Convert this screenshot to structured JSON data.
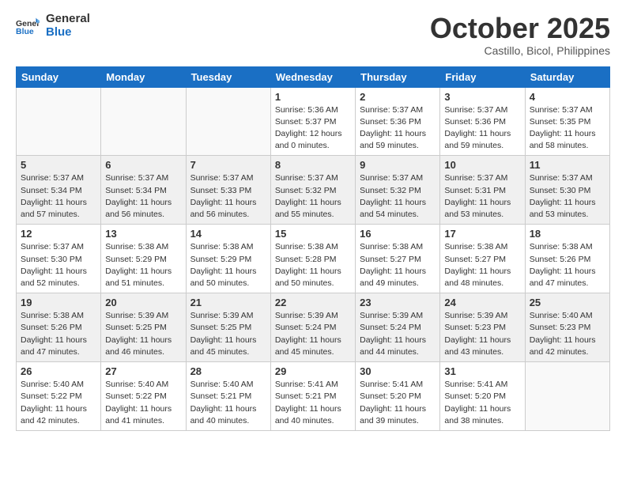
{
  "header": {
    "logo_general": "General",
    "logo_blue": "Blue",
    "month": "October 2025",
    "location": "Castillo, Bicol, Philippines"
  },
  "weekdays": [
    "Sunday",
    "Monday",
    "Tuesday",
    "Wednesday",
    "Thursday",
    "Friday",
    "Saturday"
  ],
  "weeks": [
    [
      {
        "day": "",
        "info": ""
      },
      {
        "day": "",
        "info": ""
      },
      {
        "day": "",
        "info": ""
      },
      {
        "day": "1",
        "info": "Sunrise: 5:36 AM\nSunset: 5:37 PM\nDaylight: 12 hours\nand 0 minutes."
      },
      {
        "day": "2",
        "info": "Sunrise: 5:37 AM\nSunset: 5:36 PM\nDaylight: 11 hours\nand 59 minutes."
      },
      {
        "day": "3",
        "info": "Sunrise: 5:37 AM\nSunset: 5:36 PM\nDaylight: 11 hours\nand 59 minutes."
      },
      {
        "day": "4",
        "info": "Sunrise: 5:37 AM\nSunset: 5:35 PM\nDaylight: 11 hours\nand 58 minutes."
      }
    ],
    [
      {
        "day": "5",
        "info": "Sunrise: 5:37 AM\nSunset: 5:34 PM\nDaylight: 11 hours\nand 57 minutes."
      },
      {
        "day": "6",
        "info": "Sunrise: 5:37 AM\nSunset: 5:34 PM\nDaylight: 11 hours\nand 56 minutes."
      },
      {
        "day": "7",
        "info": "Sunrise: 5:37 AM\nSunset: 5:33 PM\nDaylight: 11 hours\nand 56 minutes."
      },
      {
        "day": "8",
        "info": "Sunrise: 5:37 AM\nSunset: 5:32 PM\nDaylight: 11 hours\nand 55 minutes."
      },
      {
        "day": "9",
        "info": "Sunrise: 5:37 AM\nSunset: 5:32 PM\nDaylight: 11 hours\nand 54 minutes."
      },
      {
        "day": "10",
        "info": "Sunrise: 5:37 AM\nSunset: 5:31 PM\nDaylight: 11 hours\nand 53 minutes."
      },
      {
        "day": "11",
        "info": "Sunrise: 5:37 AM\nSunset: 5:30 PM\nDaylight: 11 hours\nand 53 minutes."
      }
    ],
    [
      {
        "day": "12",
        "info": "Sunrise: 5:37 AM\nSunset: 5:30 PM\nDaylight: 11 hours\nand 52 minutes."
      },
      {
        "day": "13",
        "info": "Sunrise: 5:38 AM\nSunset: 5:29 PM\nDaylight: 11 hours\nand 51 minutes."
      },
      {
        "day": "14",
        "info": "Sunrise: 5:38 AM\nSunset: 5:29 PM\nDaylight: 11 hours\nand 50 minutes."
      },
      {
        "day": "15",
        "info": "Sunrise: 5:38 AM\nSunset: 5:28 PM\nDaylight: 11 hours\nand 50 minutes."
      },
      {
        "day": "16",
        "info": "Sunrise: 5:38 AM\nSunset: 5:27 PM\nDaylight: 11 hours\nand 49 minutes."
      },
      {
        "day": "17",
        "info": "Sunrise: 5:38 AM\nSunset: 5:27 PM\nDaylight: 11 hours\nand 48 minutes."
      },
      {
        "day": "18",
        "info": "Sunrise: 5:38 AM\nSunset: 5:26 PM\nDaylight: 11 hours\nand 47 minutes."
      }
    ],
    [
      {
        "day": "19",
        "info": "Sunrise: 5:38 AM\nSunset: 5:26 PM\nDaylight: 11 hours\nand 47 minutes."
      },
      {
        "day": "20",
        "info": "Sunrise: 5:39 AM\nSunset: 5:25 PM\nDaylight: 11 hours\nand 46 minutes."
      },
      {
        "day": "21",
        "info": "Sunrise: 5:39 AM\nSunset: 5:25 PM\nDaylight: 11 hours\nand 45 minutes."
      },
      {
        "day": "22",
        "info": "Sunrise: 5:39 AM\nSunset: 5:24 PM\nDaylight: 11 hours\nand 45 minutes."
      },
      {
        "day": "23",
        "info": "Sunrise: 5:39 AM\nSunset: 5:24 PM\nDaylight: 11 hours\nand 44 minutes."
      },
      {
        "day": "24",
        "info": "Sunrise: 5:39 AM\nSunset: 5:23 PM\nDaylight: 11 hours\nand 43 minutes."
      },
      {
        "day": "25",
        "info": "Sunrise: 5:40 AM\nSunset: 5:23 PM\nDaylight: 11 hours\nand 42 minutes."
      }
    ],
    [
      {
        "day": "26",
        "info": "Sunrise: 5:40 AM\nSunset: 5:22 PM\nDaylight: 11 hours\nand 42 minutes."
      },
      {
        "day": "27",
        "info": "Sunrise: 5:40 AM\nSunset: 5:22 PM\nDaylight: 11 hours\nand 41 minutes."
      },
      {
        "day": "28",
        "info": "Sunrise: 5:40 AM\nSunset: 5:21 PM\nDaylight: 11 hours\nand 40 minutes."
      },
      {
        "day": "29",
        "info": "Sunrise: 5:41 AM\nSunset: 5:21 PM\nDaylight: 11 hours\nand 40 minutes."
      },
      {
        "day": "30",
        "info": "Sunrise: 5:41 AM\nSunset: 5:20 PM\nDaylight: 11 hours\nand 39 minutes."
      },
      {
        "day": "31",
        "info": "Sunrise: 5:41 AM\nSunset: 5:20 PM\nDaylight: 11 hours\nand 38 minutes."
      },
      {
        "day": "",
        "info": ""
      }
    ]
  ]
}
